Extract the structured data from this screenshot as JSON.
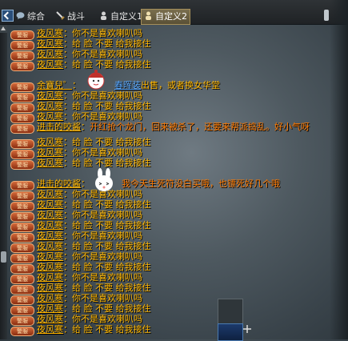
{
  "tabs": [
    {
      "label": "综合",
      "icon": "chat-bubble-icon"
    },
    {
      "label": "战斗",
      "icon": "sword-icon"
    },
    {
      "label": "自定义1",
      "icon": "person-icon"
    },
    {
      "label": "自定义2",
      "icon": "person-icon",
      "active": true
    }
  ],
  "badge": "警服",
  "messages": [
    {
      "sender": "夜风寒",
      "sep": "：",
      "text": "你不是喜欢喇叭吗"
    },
    {
      "sender": "夜风寒",
      "sep": "：",
      "text": "给 脸 不要 给我接住"
    },
    {
      "sender": "夜风寒",
      "sep": "：",
      "text": "你不是喜欢喇叭吗"
    },
    {
      "sender": "夜风寒",
      "sep": "：",
      "text": "给 脸 不要 给我接住"
    },
    {
      "sender": "余寶兒゜",
      "sep": "：",
      "link": "春晖装",
      "text": "出售，或者换女华堂"
    },
    {
      "sender": "夜风寒",
      "sep": "：",
      "text": "你不是喜欢喇叭吗"
    },
    {
      "sender": "夜风寒",
      "sep": "：",
      "text": "给 脸 不要 给我接住"
    },
    {
      "sender": "夜风寒",
      "sep": "：",
      "text": "你不是喜欢喇叭吗"
    },
    {
      "sender": "进击的咬酱",
      "sep": "：",
      "text": "开红抢个龙门，回来被杀了，还要来帮派捣乱。好小气呀"
    },
    {
      "sender": "夜风寒",
      "sep": "：",
      "text": "给 脸 不要 给我接住"
    },
    {
      "sender": "夜风寒",
      "sep": "：",
      "text": "你不是喜欢喇叭吗"
    },
    {
      "sender": "夜风寒",
      "sep": "：",
      "text": "给 脸 不要 给我接住"
    },
    {
      "sender": "进击的咬酱",
      "sep": "：",
      "text": "我今天生死符没白买哦，也镖死好几个哦"
    },
    {
      "sender": "夜风寒",
      "sep": "：",
      "text": "你不是喜欢喇叭吗"
    },
    {
      "sender": "夜风寒",
      "sep": "：",
      "text": "给 脸 不要 给我接住"
    },
    {
      "sender": "夜风寒",
      "sep": "：",
      "text": "你不是喜欢喇叭吗"
    },
    {
      "sender": "夜风寒",
      "sep": "：",
      "text": "给 脸 不要 给我接住"
    },
    {
      "sender": "夜风寒",
      "sep": "：",
      "text": "你不是喜欢喇叭吗"
    },
    {
      "sender": "夜风寒",
      "sep": "：",
      "text": "给 脸 不要 给我接住"
    },
    {
      "sender": "夜风寒",
      "sep": "：",
      "text": "你不是喜欢喇叭吗"
    },
    {
      "sender": "夜风寒",
      "sep": "：",
      "text": "给 脸 不要 给我接住"
    },
    {
      "sender": "夜风寒",
      "sep": "：",
      "text": "你不是喜欢喇叭吗"
    },
    {
      "sender": "夜风寒",
      "sep": "：",
      "text": "给 脸 不要 给我接住"
    },
    {
      "sender": "夜风寒",
      "sep": "：",
      "text": "你不是喜欢喇叭吗"
    },
    {
      "sender": "夜风寒",
      "sep": "：",
      "text": "给 脸 不要 给我接住"
    },
    {
      "sender": "夜风寒",
      "sep": "：",
      "text": "你不是喜欢喇叭吗"
    },
    {
      "sender": "夜风寒",
      "sep": "：",
      "text": "给 脸 不要 给我接住"
    }
  ]
}
